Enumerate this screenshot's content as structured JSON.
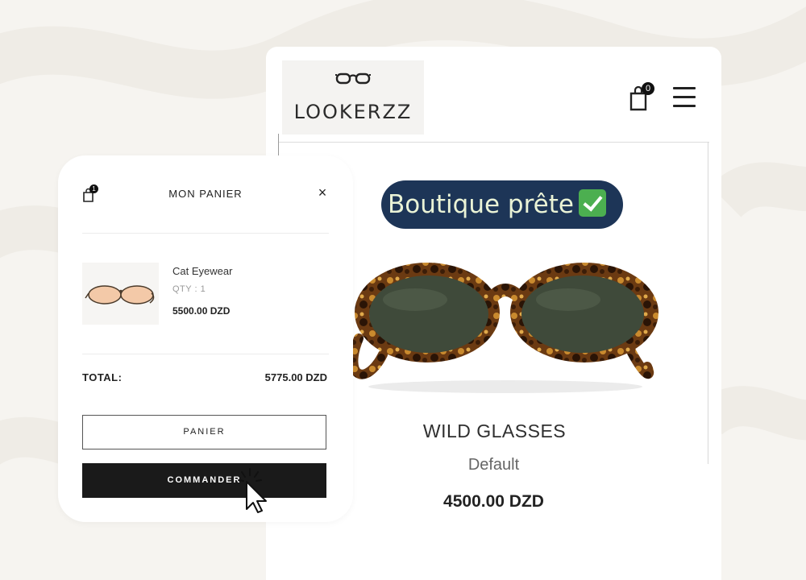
{
  "shop": {
    "brand": "LOOKERZZ",
    "cart_count": "0",
    "status_pill": "Boutique prête",
    "product": {
      "name": "WILD GLASSES",
      "variant": "Default",
      "price": "4500.00 DZD"
    }
  },
  "cart_panel": {
    "title": "MON PANIER",
    "badge_count": "1",
    "close_label": "×",
    "items": [
      {
        "name": "Cat Eyewear",
        "qty": "QTY : 1",
        "price": "5500.00 DZD"
      }
    ],
    "total_label": "TOTAL:",
    "total_value": "5775.00 DZD",
    "view_cart_label": "PANIER",
    "checkout_label": "COMMANDER"
  },
  "colors": {
    "pill_bg": "#1d3557",
    "pill_text": "#eaf3d6",
    "checkout_bg": "#1a1a1a",
    "page_bg": "#f6f4f0"
  },
  "icons": [
    "glasses-logo-icon",
    "shopping-bag-icon",
    "hamburger-menu-icon",
    "close-icon",
    "check-mark-icon",
    "mouse-cursor-icon"
  ]
}
